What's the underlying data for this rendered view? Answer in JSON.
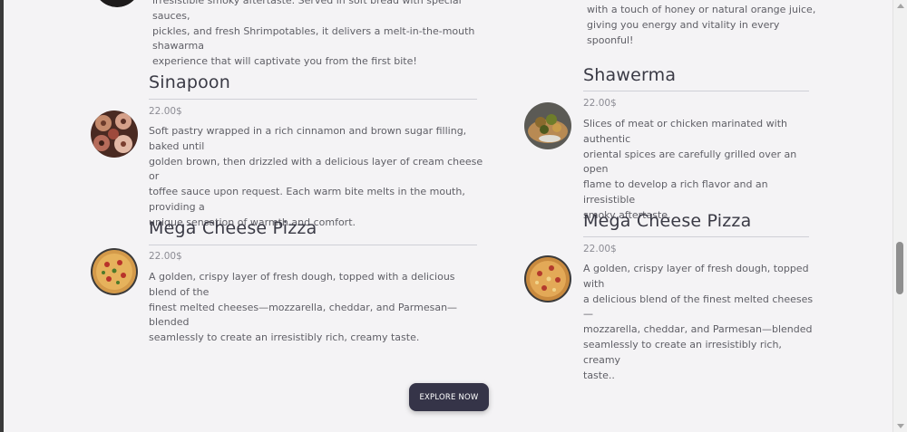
{
  "left_top_desc": "irresistible smoky aftertaste. Served in soft bread with special sauces,\npickles, and fresh Shrimpotables, it delivers a melt-in-the-mouth shawarma\nexperience that will captivate you from the first bite!",
  "right_top_desc": "with a touch of honey or natural orange juice,\ngiving you energy and vitality in every spoonful!",
  "items": [
    {
      "title": "Sinapoon",
      "price": "22.00$",
      "description": "Soft pastry wrapped in a rich cinnamon and brown sugar filling, baked until\ngolden brown, then drizzled with a delicious layer of cream cheese or\ntoffee sauce upon request. Each warm bite melts in the mouth, providing a\nunique sensation of warmth and comfort.",
      "image": "cinnamon-rolls-image"
    },
    {
      "title": "Shawerma",
      "price": "22.00$",
      "description": "Slices of meat or chicken marinated with authentic\noriental spices are carefully grilled over an open\nflame to develop a rich flavor and an irresistible\nsmoky aftertaste.",
      "image": "shawerma-image"
    },
    {
      "title": "Mega Cheese Pizza",
      "price": "22.00$",
      "description": "A golden, crispy layer of fresh dough, topped with a delicious blend of the\nfinest melted cheeses—mozzarella, cheddar, and Parmesan—blended\nseamlessly to create an irresistibly rich, creamy taste.",
      "image": "pizza-image"
    },
    {
      "title": "Mega Cheese Pizza",
      "price": "22.00$",
      "description": "A golden, crispy layer of fresh dough, topped with\na delicious blend of the finest melted cheeses—\nmozzarella, cheddar, and Parmesan—blended\nseamlessly to create an irresistibly rich, creamy\ntaste..",
      "image": "pizza-image"
    }
  ],
  "explore_button": "EXPLORE NOW"
}
